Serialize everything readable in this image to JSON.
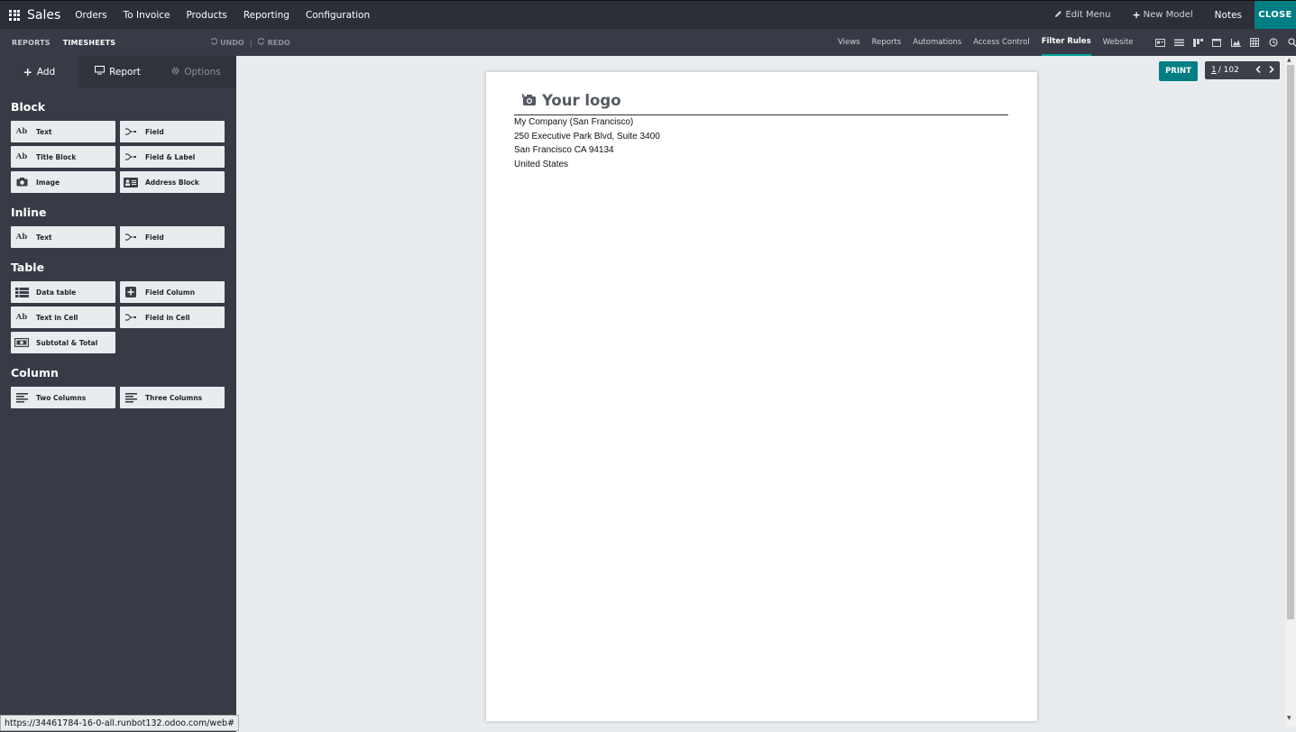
{
  "topbar": {
    "app_name": "Sales",
    "menu": [
      "Orders",
      "To Invoice",
      "Products",
      "Reporting",
      "Configuration"
    ],
    "edit_menu": "Edit Menu",
    "new_model": "New Model",
    "notes": "Notes",
    "close": "CLOSE"
  },
  "subbar": {
    "breadcrumb": [
      "REPORTS",
      "TIMESHEETS"
    ],
    "undo": "UNDO",
    "redo": "REDO",
    "nav": [
      "Views",
      "Reports",
      "Automations",
      "Access Control",
      "Filter Rules",
      "Website"
    ],
    "active_nav": "Filter Rules",
    "view_icons": [
      "form-view-icon",
      "list-view-icon",
      "kanban-view-icon",
      "calendar-view-icon",
      "graph-view-icon",
      "pivot-view-icon",
      "activity-view-icon",
      "search-icon"
    ]
  },
  "sidebar": {
    "tabs": {
      "add": "Add",
      "report": "Report",
      "options": "Options"
    },
    "sections": {
      "block": {
        "title": "Block",
        "items": [
          "Text",
          "Field",
          "Title Block",
          "Field & Label",
          "Image",
          "Address Block"
        ]
      },
      "inline": {
        "title": "Inline",
        "items": [
          "Text",
          "Field"
        ]
      },
      "table": {
        "title": "Table",
        "items": [
          "Data table",
          "Field Column",
          "Text in Cell",
          "Field in Cell",
          "Subtotal & Total"
        ]
      },
      "column": {
        "title": "Column",
        "items": [
          "Two Columns",
          "Three Columns"
        ]
      }
    },
    "icon_text": "Ab"
  },
  "document": {
    "logo": "Your logo",
    "address": [
      "My Company (San Francisco)",
      "250 Executive Park Blvd, Suite 3400",
      "San Francisco CA 94134",
      "United States"
    ]
  },
  "print": {
    "label": "PRINT",
    "page_current": "1",
    "page_total": "/ 102"
  },
  "status_url": "https://34461784-16-0-all.runbot132.odoo.com/web#",
  "colors": {
    "accent": "#017e84",
    "nav_bg": "#2b2f38",
    "sidebar_bg": "#363b45"
  }
}
